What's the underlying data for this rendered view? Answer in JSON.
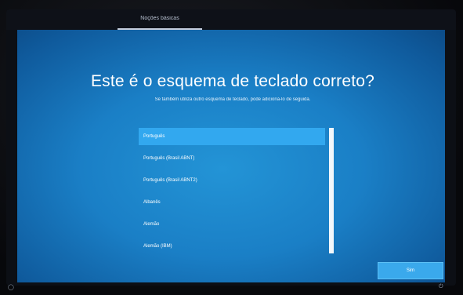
{
  "topbar": {
    "tab_label": "Noções básicas"
  },
  "setup": {
    "title": "Este é o esquema de teclado correto?",
    "subtitle": "Se também utiliza outro esquema de teclado, pode adicioná-lo de seguida.",
    "layouts": [
      {
        "label": "Português",
        "selected": true
      },
      {
        "label": "Português (Brasil ABNT)",
        "selected": false
      },
      {
        "label": "Português (Brasil ABNT2)",
        "selected": false
      },
      {
        "label": "Albanês",
        "selected": false
      },
      {
        "label": "Alemão",
        "selected": false
      },
      {
        "label": "Alemão (IBM)",
        "selected": false
      }
    ],
    "yes_label": "Sim"
  },
  "icons": {
    "accessibility": "accessibility-icon",
    "power": "power-icon"
  },
  "colors": {
    "background_blue": "#1a7fc6",
    "selected_item": "#32a8ef",
    "button": "#3aa9ec"
  }
}
